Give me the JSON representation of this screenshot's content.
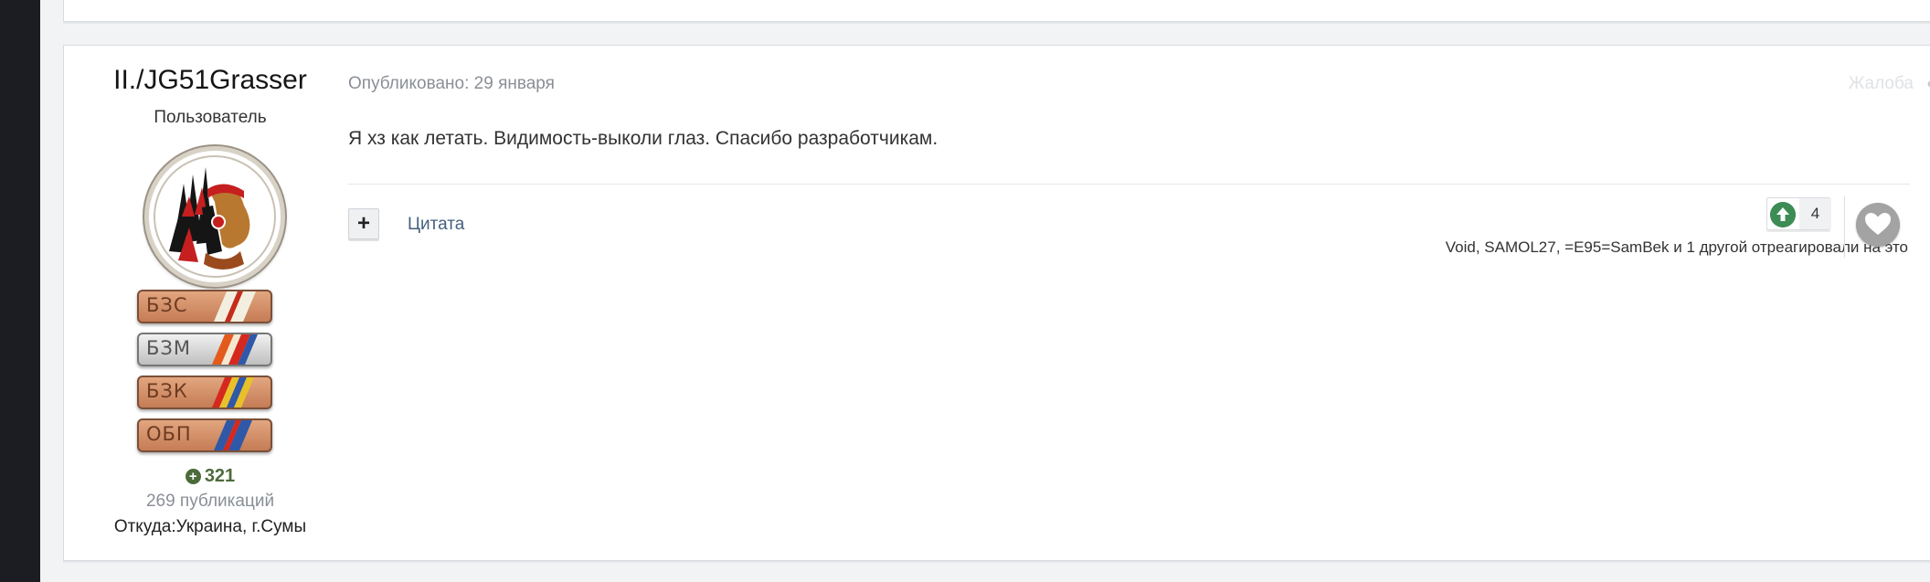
{
  "author": {
    "name": "II./JG51Grasser",
    "role": "Пользователь",
    "badges": [
      "БЗС",
      "БЗМ",
      "БЗК",
      "ОБП"
    ],
    "reputation": "321",
    "posts_count": "269 публикаций",
    "location": "Откуда:Украина, г.Сумы"
  },
  "post": {
    "published": "Опубликовано: 29 января",
    "report_label": "Жалоба",
    "text": "Я хз как летать. Видимость-выколи глаз. Спасибо разработчикам."
  },
  "actions": {
    "multiquote_label": "+",
    "quote_label": "Цитата"
  },
  "reactions": {
    "count": "4",
    "reacted_by": "Void, SAMOL27, =E95=SamBek и 1 другой отреагировали на это"
  },
  "colors": {
    "accent": "#44607e",
    "reputation": "#4c6b3b",
    "upvote": "#3d8c55",
    "sidebar": "#1b1d22"
  },
  "icons": [
    "plus-circle-icon",
    "share-icon",
    "upvote-icon",
    "heart-icon"
  ]
}
